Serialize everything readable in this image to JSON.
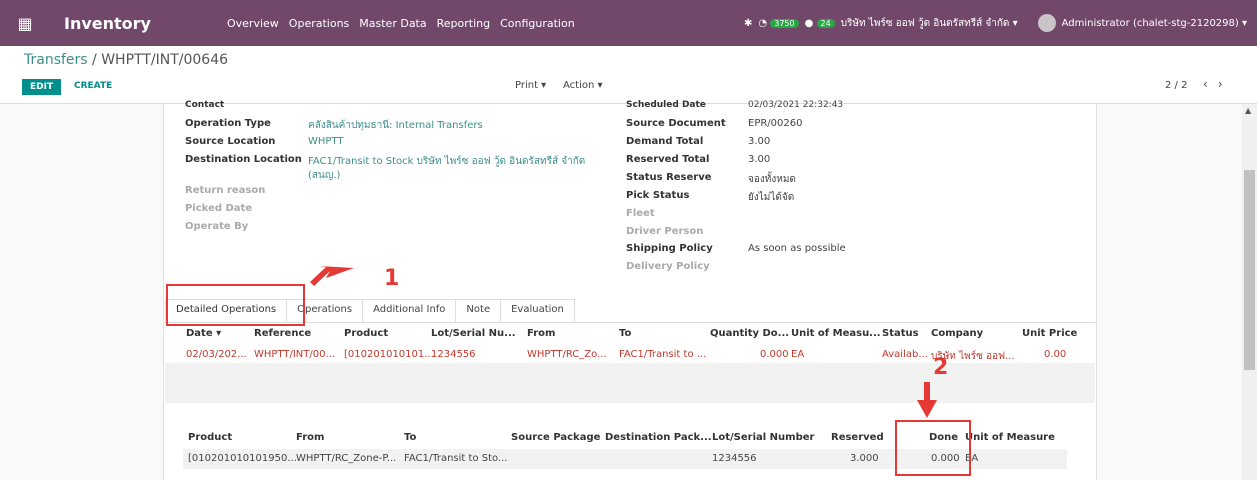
{
  "navbar": {
    "app_title": "Inventory",
    "menu": [
      "Overview",
      "Operations",
      "Master Data",
      "Reporting",
      "Configuration"
    ],
    "activity_count": "3750",
    "message_count": "24",
    "company": "บริษัท ไพร์ซ ออฟ วู้ด อินดรัสทรีส์ จำกัด",
    "user": "Administrator (chalet-stg-2120298)"
  },
  "control": {
    "breadcrumb_parent": "Transfers",
    "breadcrumb_sep": " / ",
    "breadcrumb_current": "WHPTT/INT/00646",
    "edit": "EDIT",
    "create": "CREATE",
    "print": "Print ▾",
    "action": "Action ▾",
    "pager": "2 / 2"
  },
  "form": {
    "contact_label": "Contact",
    "operation_type_label": "Operation Type",
    "operation_type": "คลังสินค้าปทุมธานี: Internal Transfers",
    "source_location_label": "Source Location",
    "source_location": "WHPTT",
    "destination_location_label": "Destination Location",
    "destination_location_1": "FAC1/Transit to Stock บริษัท ไพร์ซ ออฟ วู้ด อินดรัสทรีส์ จำกัด",
    "destination_location_2": "(สนญ.)",
    "return_reason_label": "Return reason",
    "picked_date_label": "Picked Date",
    "operate_by_label": "Operate By",
    "scheduled_date_label": "Scheduled Date",
    "scheduled_date": "02/03/2021 22:32:43",
    "source_document_label": "Source Document",
    "source_document": "EPR/00260",
    "demand_total_label": "Demand Total",
    "demand_total": "3.00",
    "reserved_total_label": "Reserved Total",
    "reserved_total": "3.00",
    "status_reserve_label": "Status Reserve",
    "status_reserve": "จองทั้งหมด",
    "pick_status_label": "Pick Status",
    "pick_status": "ยังไม่ได้จัด",
    "fleet_label": "Fleet",
    "driver_person_label": "Driver Person",
    "shipping_policy_label": "Shipping Policy",
    "shipping_policy": "As soon as possible",
    "delivery_policy_label": "Delivery Policy"
  },
  "tabs": [
    "Detailed Operations",
    "Operations",
    "Additional Info",
    "Note",
    "Evaluation"
  ],
  "detailed_table": {
    "headers": [
      "Date ▾",
      "Reference",
      "Product",
      "Lot/Serial Nu...",
      "From",
      "To",
      "Quantity Do...",
      "Unit of Measu...",
      "Status",
      "Company",
      "Unit Price"
    ],
    "row": [
      "02/03/202...",
      "WHPTT/INT/00...",
      "[010201010101...",
      "1234556",
      "WHPTT/RC_Zo...",
      "FAC1/Transit to ...",
      "0.000",
      "EA",
      "Availab...",
      "บริษัท ไพร์ซ ออฟ...",
      "0.00"
    ]
  },
  "ops_table": {
    "headers": [
      "Product",
      "From",
      "To",
      "Source Package",
      "Destination Pack...",
      "Lot/Serial Number",
      "Reserved",
      "Done",
      "Unit of Measure"
    ],
    "row": [
      "[010201010101950...",
      "WHPTT/RC_Zone-P...",
      "FAC1/Transit to Sto...",
      "",
      "",
      "1234556",
      "3.000",
      "0.000",
      "EA"
    ]
  },
  "annotations": {
    "one": "1",
    "two": "2"
  },
  "colors": {
    "navbar": "#71486a",
    "accent": "#008f8c",
    "annotation": "#e53935"
  }
}
